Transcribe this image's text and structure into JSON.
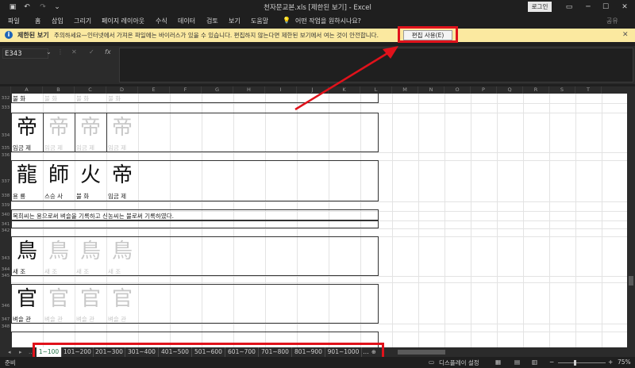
{
  "titlebar": {
    "title": "천자문교본.xls [제한된 보기] - Excel",
    "login": "로그인",
    "save_icon": "save-icon",
    "undo_icon": "undo-icon",
    "redo_icon": "redo-icon"
  },
  "menu": {
    "items": [
      "파일",
      "홈",
      "삽입",
      "그리기",
      "페이지 레이아웃",
      "수식",
      "데이터",
      "검토",
      "보기",
      "도움말"
    ],
    "tell_me": "어떤 작업을 원하시나요?",
    "share": "공유"
  },
  "message_bar": {
    "title": "제한된 보기",
    "text": "주의하세요—인터넷에서 가져온 파일에는 바이러스가 있을 수 있습니다. 편집하지 않는다면 제한된 보기에서 여는 것이 안전합니다.",
    "button": "편집 사용(E)"
  },
  "formula_bar": {
    "name_box": "E343",
    "fx": "fx"
  },
  "columns": [
    "A",
    "B",
    "C",
    "D",
    "E",
    "F",
    "G",
    "H",
    "I",
    "J",
    "K",
    "L",
    "M",
    "N",
    "O",
    "P",
    "Q",
    "R",
    "S",
    "T"
  ],
  "rows": [
    "332",
    "333",
    "334",
    "335",
    "336",
    "337",
    "338",
    "339",
    "340",
    "341",
    "342",
    "343",
    "344",
    "345",
    "346",
    "347",
    "348"
  ],
  "sheet": {
    "row332": {
      "labels": [
        "불 화",
        "불 화",
        "불 화",
        "불 화"
      ]
    },
    "block1": {
      "chars": [
        "帝",
        "帝",
        "帝",
        "帝"
      ],
      "labels": [
        "임금 제",
        "임금 제",
        "임금 제",
        "임금 제"
      ]
    },
    "block2": {
      "chars": [
        "龍",
        "師",
        "火",
        "帝"
      ],
      "labels": [
        "용 룡",
        "스승 사",
        "불 화",
        "임금 제"
      ]
    },
    "sentence": "복희씨는 용으로써 벼슬을 기록하고 신농씨는 불로써 기록하였다.",
    "block3": {
      "chars": [
        "鳥",
        "鳥",
        "鳥",
        "鳥"
      ],
      "labels": [
        "새 조",
        "새 조",
        "새 조",
        "새 조"
      ]
    },
    "block4": {
      "chars": [
        "官",
        "官",
        "官",
        "官"
      ],
      "labels": [
        "벼슬 관",
        "벼슬 관",
        "벼슬 관",
        "벼슬 관"
      ]
    }
  },
  "tabs": [
    "1~100",
    "101~200",
    "201~300",
    "301~400",
    "401~500",
    "501~600",
    "601~700",
    "701~800",
    "801~900",
    "901~1000",
    "..."
  ],
  "status": {
    "ready": "준비",
    "display_settings": "디스플레이 설정",
    "zoom": "75%"
  }
}
